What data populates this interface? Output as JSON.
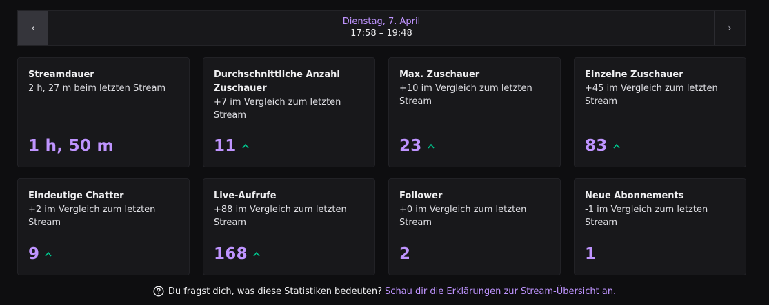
{
  "nav": {
    "prev_glyph": "‹",
    "next_glyph": "›",
    "date": "Dienstag, 7. April",
    "time_range": "17:58 – 19:48"
  },
  "cards": [
    {
      "title": "Streamdauer",
      "sub": "2 h, 27 m beim letzten Stream",
      "value": "1 h, 50 m",
      "trend": "none"
    },
    {
      "title": "Durchschnittliche Anzahl Zuschauer",
      "sub": "+7 im Vergleich zum letzten Stream",
      "value": "11",
      "trend": "up"
    },
    {
      "title": "Max. Zuschauer",
      "sub": "+10 im Vergleich zum letzten Stream",
      "value": "23",
      "trend": "up"
    },
    {
      "title": "Einzelne Zuschauer",
      "sub": "+45 im Vergleich zum letzten Stream",
      "value": "83",
      "trend": "up"
    },
    {
      "title": "Eindeutige Chatter",
      "sub": "+2 im Vergleich zum letzten Stream",
      "value": "9",
      "trend": "up"
    },
    {
      "title": "Live-Aufrufe",
      "sub": "+88 im Vergleich zum letzten Stream",
      "value": "168",
      "trend": "up"
    },
    {
      "title": "Follower",
      "sub": "+0 im Vergleich zum letzten Stream",
      "value": "2",
      "trend": "none"
    },
    {
      "title": "Neue Abonnements",
      "sub": "-1 im Vergleich zum letzten Stream",
      "value": "1",
      "trend": "none"
    }
  ],
  "footer": {
    "question": "Du fragst dich, was diese Statistiken bedeuten?",
    "link": "Schau dir die Erklärungen zur Stream-Übersicht an."
  },
  "colors": {
    "accent": "#bf94ff",
    "trend_up": "#00c48c",
    "background": "#0e0e10",
    "card": "#18181b"
  },
  "icons": {
    "trend": "arrow-up-icon",
    "help": "help-circle-icon"
  }
}
